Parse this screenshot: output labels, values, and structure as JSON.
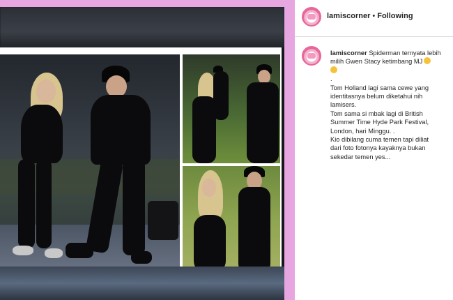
{
  "post": {
    "author": "lamiscorner",
    "separator": "•",
    "follow_status": "Following"
  },
  "caption": {
    "username": "lamiscorner",
    "first_line_text": "Spiderman ternyata lebih",
    "lines": [
      "milih Gwen Stacy ketimbang MJ",
      ".",
      "Tom Holland lagi sama cewe yang",
      "identitasnya belum diketahui nih",
      "lamisers.",
      "Tom sama si mbak lagi di British",
      "Summer Time Hyde Park Festival,",
      "London, hari Minggu. .",
      "Kio dibilang cuma temen tapi diliat",
      "dari foto fotonya kayaknya bukan",
      "sekedar temen yes..."
    ],
    "emoji_icons": [
      "smiling-face-emoji",
      "grimacing-face-emoji"
    ]
  },
  "colors": {
    "page_background": "#e7a6e0",
    "avatar_ring": "#e8679a"
  }
}
